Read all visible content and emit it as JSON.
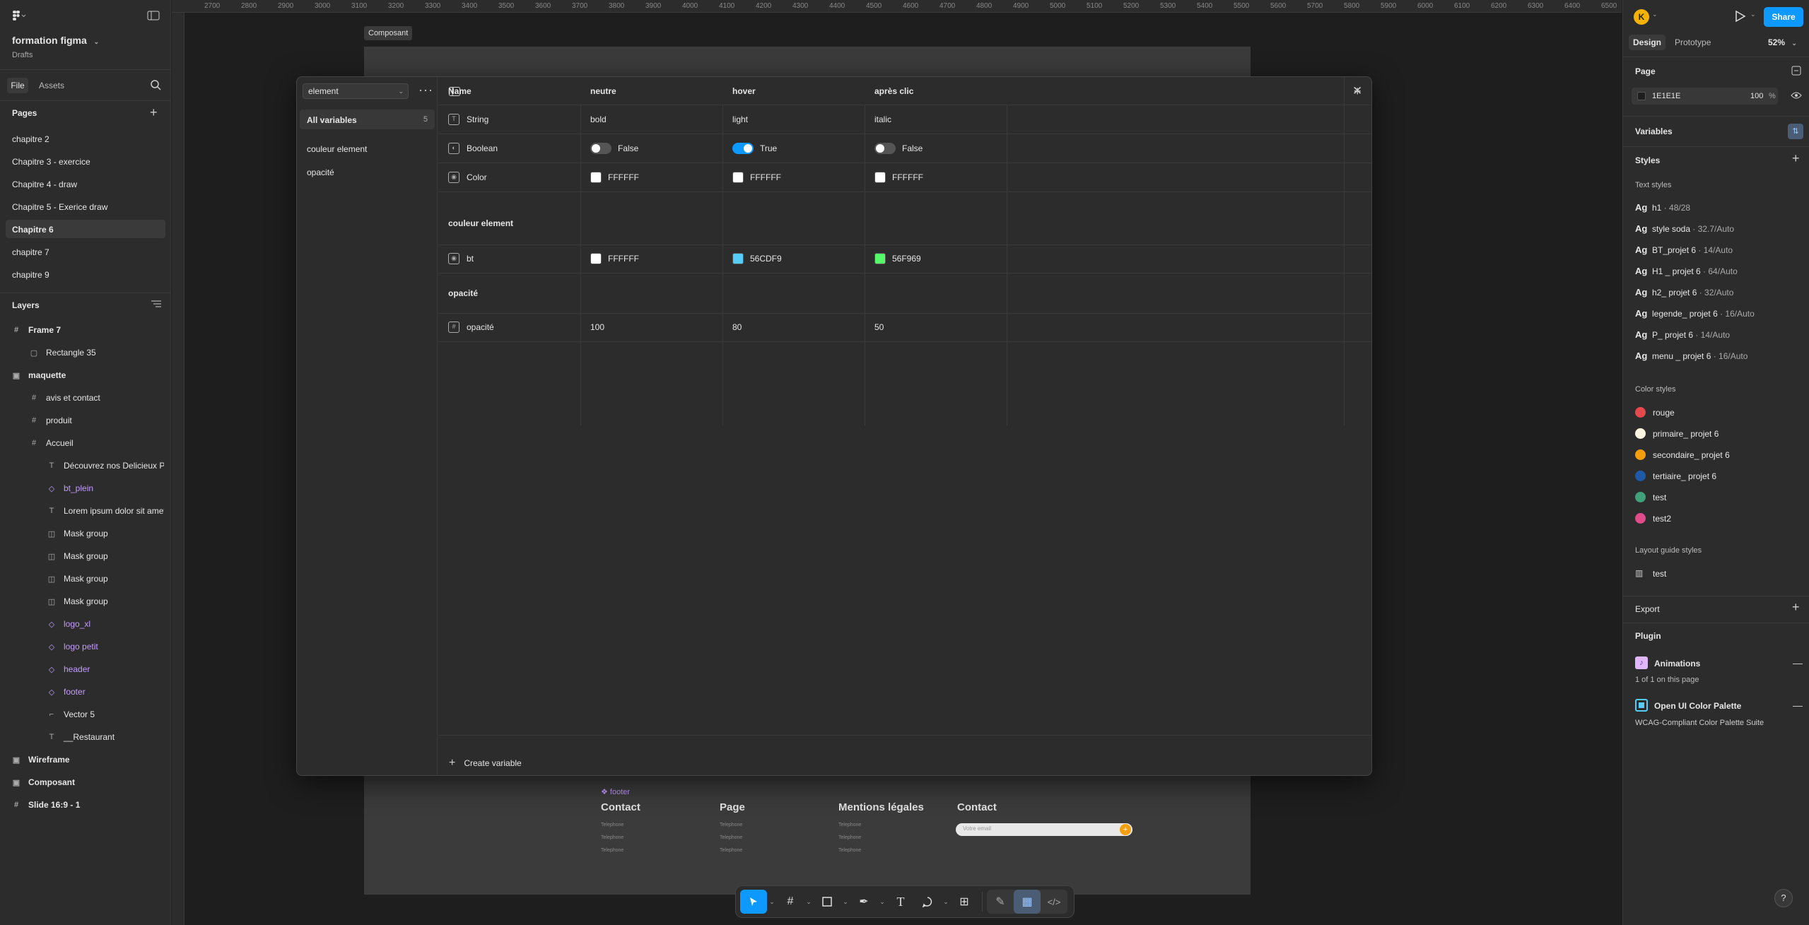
{
  "file": {
    "name": "formation figma",
    "location": "Drafts"
  },
  "left_tabs": {
    "file": "File",
    "assets": "Assets"
  },
  "pages": {
    "title": "Pages",
    "items": [
      "chapitre 2",
      "Chapitre 3 - exercice",
      "Chapitre 4 - draw",
      "Chapitre 5 - Exerice draw",
      "Chapitre 6",
      "chapitre 7",
      "chapitre 9"
    ],
    "selected": "Chapitre 6"
  },
  "layers": {
    "title": "Layers",
    "items": [
      {
        "name": "Frame 7",
        "icon": "frame-icon",
        "indent": 0,
        "kind": "frame"
      },
      {
        "name": "Rectangle 35",
        "icon": "rect-icon",
        "indent": 1,
        "kind": "shape"
      },
      {
        "name": "maquette",
        "icon": "section-icon",
        "indent": 0,
        "kind": "frame"
      },
      {
        "name": "avis et contact",
        "icon": "frame-icon",
        "indent": 1,
        "kind": "shape"
      },
      {
        "name": "produit",
        "icon": "frame-icon",
        "indent": 1,
        "kind": "shape"
      },
      {
        "name": "Accueil",
        "icon": "frame-icon",
        "indent": 1,
        "kind": "shape"
      },
      {
        "name": "Découvrez nos Delicieux Produits",
        "icon": "text-icon",
        "indent": 2,
        "kind": "shape"
      },
      {
        "name": "bt_plein",
        "icon": "component-icon",
        "indent": 2,
        "kind": "comp"
      },
      {
        "name": "Lorem ipsum dolor sit amet c",
        "icon": "text-icon",
        "indent": 2,
        "kind": "shape"
      },
      {
        "name": "Mask group",
        "icon": "mask-icon",
        "indent": 2,
        "kind": "shape"
      },
      {
        "name": "Mask group",
        "icon": "mask-icon",
        "indent": 2,
        "kind": "shape"
      },
      {
        "name": "Mask group",
        "icon": "mask-icon",
        "indent": 2,
        "kind": "shape"
      },
      {
        "name": "Mask group",
        "icon": "mask-icon",
        "indent": 2,
        "kind": "shape"
      },
      {
        "name": "logo_xl",
        "icon": "component-icon",
        "indent": 2,
        "kind": "comp"
      },
      {
        "name": "logo petit",
        "icon": "component-icon",
        "indent": 2,
        "kind": "comp"
      },
      {
        "name": "header",
        "icon": "component-icon",
        "indent": 2,
        "kind": "comp"
      },
      {
        "name": "footer",
        "icon": "component-icon",
        "indent": 2,
        "kind": "comp"
      },
      {
        "name": "Vector 5",
        "icon": "vector-icon",
        "indent": 2,
        "kind": "shape"
      },
      {
        "name": "__Restaurant",
        "icon": "text-icon",
        "indent": 2,
        "kind": "shape"
      },
      {
        "name": "Wireframe",
        "icon": "section-icon",
        "indent": 0,
        "kind": "frame"
      },
      {
        "name": "Composant",
        "icon": "section-icon",
        "indent": 0,
        "kind": "frame"
      },
      {
        "name": "Slide 16:9 - 1",
        "icon": "frame-icon",
        "indent": 0,
        "kind": "frame"
      }
    ]
  },
  "ruler": {
    "marks": [
      "2700",
      "2800",
      "2900",
      "3000",
      "3100",
      "3200",
      "3300",
      "3400",
      "3500",
      "3600",
      "3700",
      "3800",
      "3900",
      "4000",
      "4100",
      "4200",
      "4300",
      "4400",
      "4500",
      "4600",
      "4700",
      "4800",
      "4900",
      "5000",
      "5100",
      "5200",
      "5300",
      "5400",
      "5500",
      "5600",
      "5700",
      "5800",
      "5900",
      "6000",
      "6100",
      "6200",
      "6300",
      "6400",
      "6500"
    ]
  },
  "canvas": {
    "frame_label": "Composant",
    "footer_label": "footer",
    "footer_cols": [
      "Contact",
      "Page",
      "Mentions légales",
      "Contact"
    ],
    "footer_small": "Telephone",
    "email_placeholder": "Votre email"
  },
  "modal": {
    "collection": "element",
    "sidebar": {
      "all": "All variables",
      "count": "5",
      "groups": [
        "couleur element",
        "opacité"
      ]
    },
    "columns": [
      "Name",
      "neutre",
      "hover",
      "après clic"
    ],
    "rows": [
      {
        "name": "String",
        "icon": "string-icon",
        "v": [
          "bold",
          "light",
          "italic"
        ]
      },
      {
        "name": "Boolean",
        "icon": "boolean-icon",
        "v": [
          "False",
          "True",
          "False"
        ]
      },
      {
        "name": "Color",
        "icon": "color-icon",
        "v": [
          "FFFFFF",
          "FFFFFF",
          "FFFFFF"
        ],
        "swatch": [
          "#FFFFFF",
          "#FFFFFF",
          "#FFFFFF"
        ]
      }
    ],
    "group1": {
      "title": "couleur element",
      "row": {
        "name": "bt",
        "v": [
          "FFFFFF",
          "56CDF9",
          "56F969"
        ],
        "swatch": [
          "#FFFFFF",
          "#56CDF9",
          "#56F969"
        ]
      }
    },
    "group2": {
      "title": "opacité",
      "row": {
        "name": "opacité",
        "v": [
          "100",
          "80",
          "50"
        ]
      }
    },
    "create": "Create variable"
  },
  "right": {
    "avatar": "K",
    "share": "Share",
    "tabs": {
      "design": "Design",
      "prototype": "Prototype",
      "zoom": "52%"
    },
    "page": {
      "title": "Page",
      "color": "1E1E1E",
      "opacity": "100",
      "pct": "%"
    },
    "variables": "Variables",
    "styles": "Styles",
    "text_styles": {
      "title": "Text styles",
      "items": [
        {
          "name": "h1",
          "meta": " · 48/28"
        },
        {
          "name": "style soda",
          "meta": " · 32.7/Auto"
        },
        {
          "name": "BT_projet 6",
          "meta": " · 14/Auto"
        },
        {
          "name": "H1 _ projet 6",
          "meta": " · 64/Auto"
        },
        {
          "name": "h2_ projet 6",
          "meta": " · 32/Auto"
        },
        {
          "name": "legende_ projet 6",
          "meta": " · 16/Auto"
        },
        {
          "name": "P_ projet 6",
          "meta": " · 14/Auto"
        },
        {
          "name": "menu _ projet 6",
          "meta": " · 16/Auto"
        }
      ]
    },
    "color_styles": {
      "title": "Color styles",
      "items": [
        {
          "name": "rouge",
          "color": "#E5484D"
        },
        {
          "name": "primaire_ projet 6",
          "color": "#FFF4E0"
        },
        {
          "name": "secondaire_ projet 6",
          "color": "#F59E0B"
        },
        {
          "name": "tertiaire_ projet 6",
          "color": "#1E5AA8"
        },
        {
          "name": "test",
          "color": "#3FA07A"
        },
        {
          "name": "test2",
          "color": "#E04C8A"
        }
      ]
    },
    "layout_styles": {
      "title": "Layout guide styles",
      "items": [
        "test"
      ]
    },
    "export": "Export",
    "plugin": "Plugin",
    "animations": {
      "title": "Animations",
      "sub": "1 of 1 on this page"
    },
    "palette": {
      "title": "Open UI Color Palette",
      "sub": "WCAG-Compliant Color Palette Suite"
    }
  },
  "help": "?"
}
